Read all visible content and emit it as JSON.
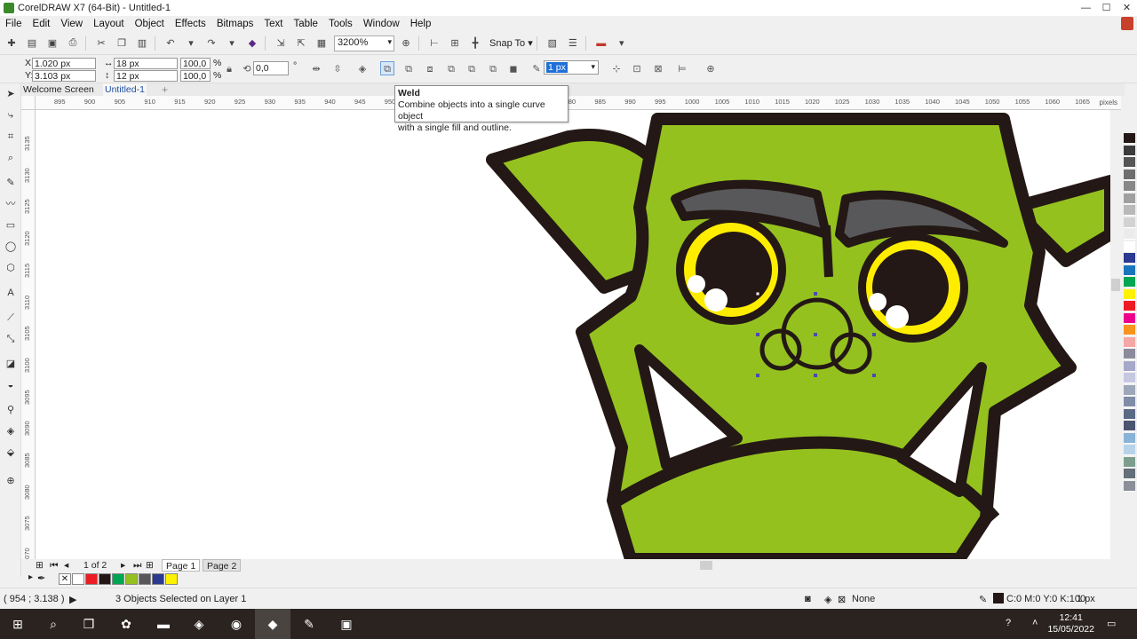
{
  "app": {
    "title": "CorelDRAW X7 (64-Bit) - Untitled-1",
    "window_controls": [
      "—",
      "☐",
      "✕"
    ]
  },
  "menu": [
    "File",
    "Edit",
    "View",
    "Layout",
    "Object",
    "Effects",
    "Bitmaps",
    "Text",
    "Table",
    "Tools",
    "Window",
    "Help"
  ],
  "toolbar": {
    "zoom_value": "3200%",
    "snap_to_label": "Snap To"
  },
  "property_bar": {
    "x_label": "X:",
    "x_value": "1.020 px",
    "y_label": "Y:",
    "y_value": "3.103 px",
    "width_value": "18 px",
    "height_value": "12 px",
    "scale_w": "100,0",
    "scale_h": "100,0",
    "percent": "%",
    "rotation_value": "0,0",
    "degree": "°",
    "outline_width": "1 px"
  },
  "tooltip": {
    "title": "Weld",
    "line1": "Combine objects into a single curve object",
    "line2": "with a single fill and outline."
  },
  "doc_tabs": {
    "welcome": "Welcome Screen",
    "untitled": "Untitled-1"
  },
  "rulers": {
    "h_ticks": [
      "895",
      "900",
      "905",
      "910",
      "915",
      "920",
      "925",
      "930",
      "935",
      "940",
      "945",
      "950",
      "955",
      "960",
      "965",
      "970",
      "975",
      "980",
      "985",
      "990",
      "995",
      "1000",
      "1005",
      "1010",
      "1015",
      "1020",
      "1025",
      "1030",
      "1035",
      "1040",
      "1045",
      "1050",
      "1055",
      "1060",
      "1065"
    ],
    "h_unit": "pixels",
    "v_ticks": [
      "3135",
      "3130",
      "3125",
      "3120",
      "3115",
      "3110",
      "3105",
      "3100",
      "3095",
      "3090",
      "3085",
      "3080",
      "3075",
      "3070"
    ],
    "v_unit": "pixels"
  },
  "page_nav": {
    "counter": "1 of 2",
    "page1": "Page 1",
    "page2": "Page 2"
  },
  "status": {
    "coords": "( 954 ; 3.138 )",
    "selection": "3 Objects Selected on Layer 1",
    "fill_label": "None",
    "outline_color": "C:0 M:0 Y:0 K:100",
    "outline_width": "1 px"
  },
  "colors": {
    "goblin_green": "#95c11f",
    "outline_dark": "#231815",
    "eyebrow_gray": "#58585a",
    "eye_yellow": "#ffed00",
    "selection_blue": "#1e6fd9"
  },
  "palette_colors": [
    "#231815",
    "#3c3c3c",
    "#555555",
    "#6e6e6e",
    "#878787",
    "#a0a0a0",
    "#b9b9b9",
    "#d2d2d2",
    "#ebebeb",
    "#ffffff",
    "#2b3990",
    "#1b75bc",
    "#00a651",
    "#fff200",
    "#ed1c24",
    "#ec008c",
    "#f7941d",
    "#f4a7a4",
    "#8b8b9b",
    "#a6a8c9",
    "#c6c8e0",
    "#9ea7b8",
    "#7f8ea6",
    "#5b6a84",
    "#4a5570",
    "#8ab3d8",
    "#b7d3ea",
    "#7d9e8e",
    "#636f7a",
    "#8a8f98"
  ],
  "doc_palette_colors": [
    "#ffffff",
    "#ffffff",
    "#ed1c24",
    "#231815",
    "#00a651",
    "#95c11f",
    "#58585a",
    "#2b3990",
    "#fff200"
  ],
  "taskbar": {
    "time": "12:41",
    "date": "15/05/2022",
    "apps": [
      "windows-start",
      "search",
      "task-view",
      "coreldraw-prev",
      "brave",
      "chrome",
      "file-explorer",
      "coreldraw",
      "paint",
      "photos"
    ]
  }
}
